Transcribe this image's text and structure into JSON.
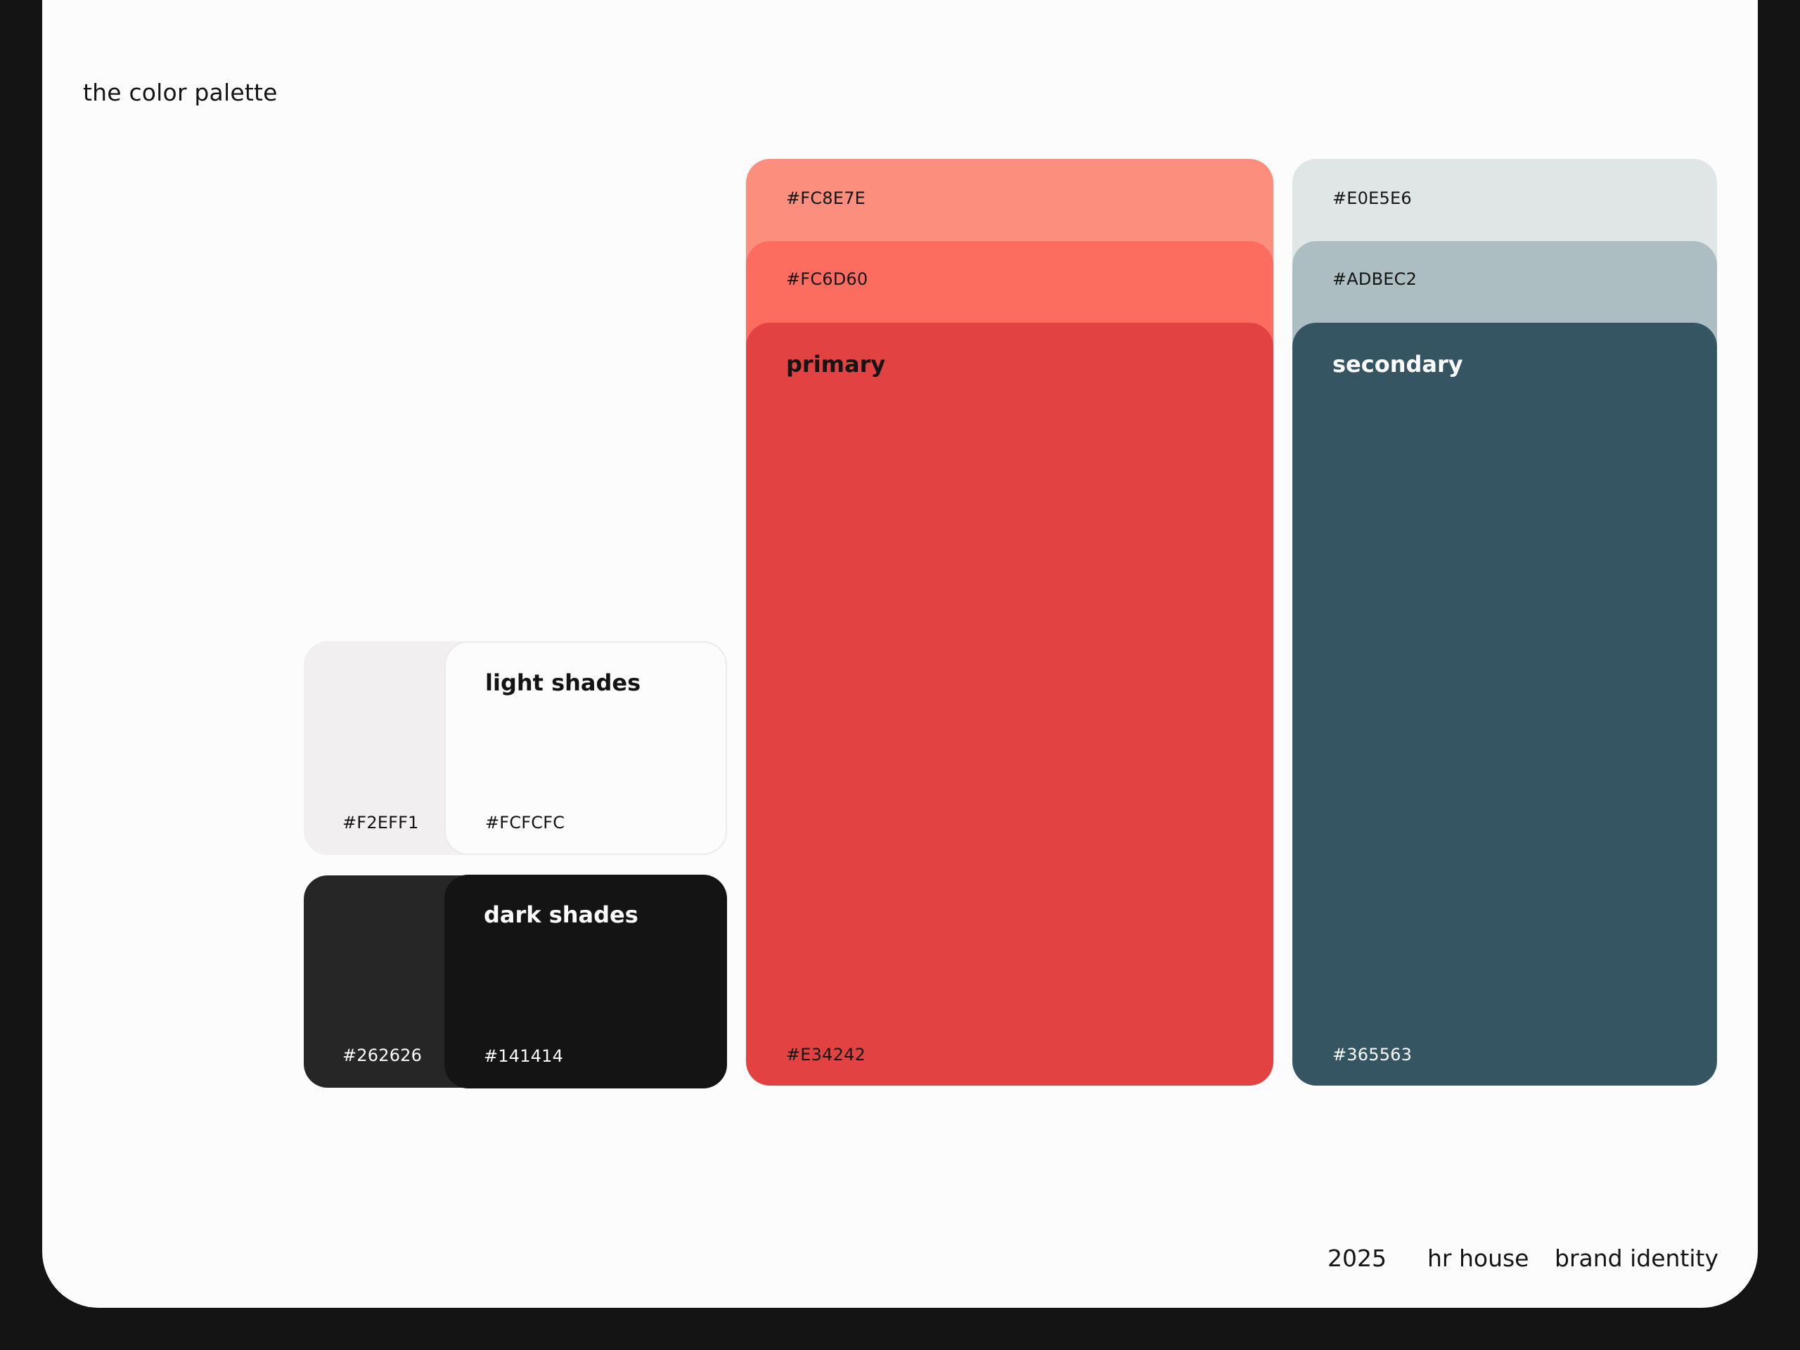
{
  "page": {
    "title": "the color palette"
  },
  "palette": {
    "light_shades": {
      "label": "light shades",
      "colors": [
        "#F2EFF1",
        "#FCFCFC"
      ]
    },
    "dark_shades": {
      "label": "dark shades",
      "colors": [
        "#262626",
        "#141414"
      ]
    },
    "primary": {
      "label": "primary",
      "tints": [
        "#FC8E7E",
        "#FC6D60"
      ],
      "main": "#E34242"
    },
    "secondary": {
      "label": "secondary",
      "tints": [
        "#E0E5E6",
        "#ADBEC2"
      ],
      "main": "#365563"
    }
  },
  "footer": {
    "year": "2025",
    "client": "hr house",
    "project": "brand identity"
  }
}
